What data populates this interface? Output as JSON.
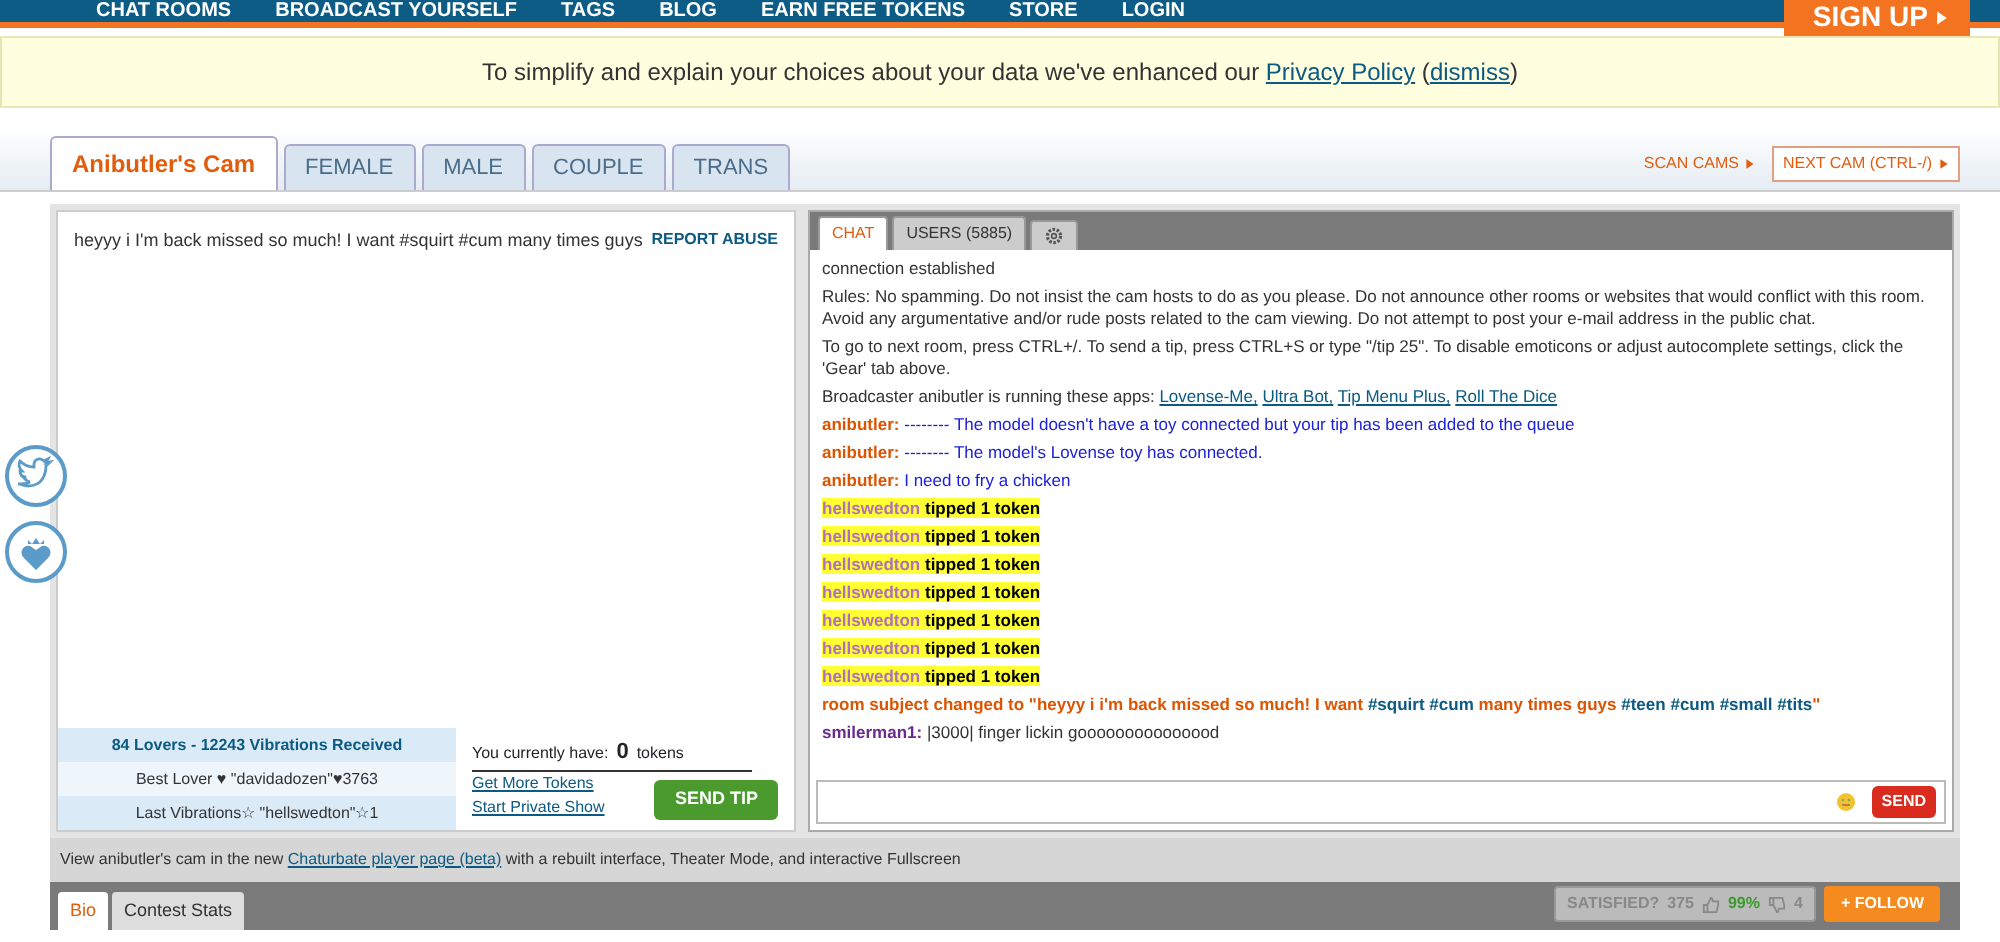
{
  "nav": {
    "items": [
      "CHAT ROOMS",
      "BROADCAST YOURSELF",
      "TAGS",
      "BLOG",
      "EARN FREE TOKENS",
      "STORE",
      "LOGIN"
    ],
    "signup": "SIGN UP"
  },
  "notice": {
    "text": "To simplify and explain your choices about your data we've enhanced our",
    "link": "Privacy Policy",
    "dismiss_open": "(",
    "dismiss": "dismiss",
    "dismiss_close": ")"
  },
  "tabs": [
    {
      "label": "Anibutler's Cam",
      "selected": true
    },
    {
      "label": "FEMALE",
      "selected": false
    },
    {
      "label": "MALE",
      "selected": false
    },
    {
      "label": "COUPLE",
      "selected": false
    },
    {
      "label": "TRANS",
      "selected": false
    }
  ],
  "scan_cams": "SCAN CAMS",
  "next_cam": "NEXT CAM (CTRL-/)",
  "video": {
    "subject": "heyyy i I'm back missed so much! I want #squirt #cum many times guys",
    "report": "REPORT ABUSE"
  },
  "lovense": [
    "84 Lovers - 12243 Vibrations Received",
    "Best Lover ♥ \"davidadozen\"♥3763",
    "Last Vibrations☆ \"hellswedton\"☆1"
  ],
  "tokens": {
    "label": "You currently have:",
    "count": "0",
    "unit": "tokens",
    "get_more": "Get More Tokens",
    "private": "Start Private Show",
    "send_tip": "SEND TIP"
  },
  "chat_tabs": [
    {
      "label": "CHAT",
      "kind": "text",
      "selected": true
    },
    {
      "label": "USERS (5885)",
      "kind": "text",
      "selected": false
    },
    {
      "kind": "gear",
      "selected": false
    }
  ],
  "messages": [
    {
      "kind": "notice",
      "text": "connection established"
    },
    {
      "kind": "notice",
      "text": "Rules: No spamming. Do not insist the cam hosts to do as you please. Do not announce other rooms or websites that would conflict with this room. Avoid any argumentative and/or rude posts related to the cam viewing. Do not attempt to post your e-mail address in the public chat."
    },
    {
      "kind": "notice",
      "text": "To go to next room, press CTRL+/. To send a tip, press CTRL+S or type \"/tip 25\". To disable emoticons or adjust autocomplete settings, click the 'Gear' tab above."
    },
    {
      "kind": "apps",
      "text": "Broadcaster anibutler is running these apps:",
      "apps": [
        "Lovense-Me,",
        "Ultra Bot,",
        "Tip Menu Plus,",
        "Roll The Dice"
      ]
    },
    {
      "kind": "broadcaster",
      "user": "anibutler:",
      "text": "-------- The model doesn't have a toy connected but your tip has been added to the queue"
    },
    {
      "kind": "broadcaster",
      "user": "anibutler:",
      "text": "-------- The model's Lovense toy has connected."
    },
    {
      "kind": "broadcaster",
      "user": "anibutler:",
      "text": "I need to fry a chicken"
    },
    {
      "kind": "tip",
      "user": "hellswedton",
      "text": "tipped 1 token"
    },
    {
      "kind": "tip",
      "user": "hellswedton",
      "text": "tipped 1 token"
    },
    {
      "kind": "tip",
      "user": "hellswedton",
      "text": "tipped 1 token"
    },
    {
      "kind": "tip",
      "user": "hellswedton",
      "text": "tipped 1 token"
    },
    {
      "kind": "tip",
      "user": "hellswedton",
      "text": "tipped 1 token"
    },
    {
      "kind": "tip",
      "user": "hellswedton",
      "text": "tipped 1 token"
    },
    {
      "kind": "tip",
      "user": "hellswedton",
      "text": "tipped 1 token"
    },
    {
      "kind": "subject",
      "parts": [
        {
          "text": "room subject changed to \"heyyy i i'm back missed so much! I want",
          "hashtag": false
        },
        {
          "text": "#squirt",
          "hashtag": true
        },
        {
          "text": "#cum",
          "hashtag": true
        },
        {
          "text": "many times guys",
          "hashtag": false
        },
        {
          "text": "#teen",
          "hashtag": true
        },
        {
          "text": "#cum",
          "hashtag": true
        },
        {
          "text": "#small",
          "hashtag": true
        },
        {
          "text": "#tits",
          "hashtag": true
        },
        {
          "text": "\"",
          "hashtag": false
        }
      ]
    },
    {
      "kind": "viewer",
      "user": "smilerman1:",
      "text": "|3000| finger lickin gooooooooooooood"
    }
  ],
  "send": "SEND",
  "player_note": {
    "before": "View anibutler's cam in the new",
    "link": "Chaturbate player page (beta)",
    "after": "with a rebuilt interface, Theater Mode, and interactive Fullscreen"
  },
  "bio_tabs": [
    {
      "label": "Bio",
      "selected": true
    },
    {
      "label": "Contest Stats",
      "selected": false
    }
  ],
  "satisfied": {
    "label": "SATISFIED?",
    "count": "375",
    "up": "99%",
    "down": "4"
  },
  "follow": "+ FOLLOW"
}
